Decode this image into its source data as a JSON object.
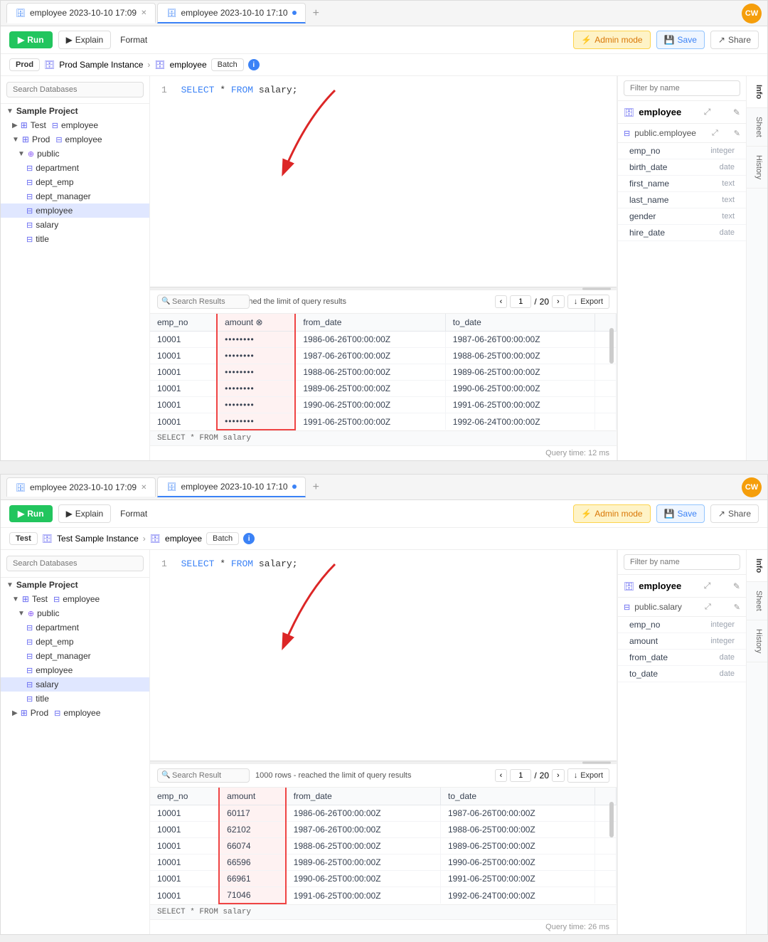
{
  "panel1": {
    "tabs": [
      {
        "id": "tab1",
        "label": "employee 2023-10-10 17:09",
        "active": true,
        "closable": true,
        "dot": false
      },
      {
        "id": "tab2",
        "label": "employee 2023-10-10 17:10",
        "active": false,
        "closable": false,
        "dot": true
      },
      {
        "id": "add",
        "label": "+",
        "active": false
      }
    ],
    "toolbar": {
      "run": "▶ Run",
      "explain": "▶ Explain",
      "format": "Format",
      "admin_mode": "⚡ Admin mode",
      "save": "💾 Save",
      "share": "↗ Share"
    },
    "context": {
      "env": "Prod",
      "instance": "Prod Sample Instance",
      "db": "employee",
      "batch": "Batch"
    },
    "sql": "SELECT * FROM salary;",
    "line_num": "1",
    "sidebar": {
      "search_placeholder": "Search Databases",
      "project_label": "Sample Project",
      "items": [
        {
          "type": "db",
          "label": "Test",
          "sub": "employee",
          "indent": 1
        },
        {
          "type": "db",
          "label": "Prod",
          "sub": "employee",
          "indent": 1
        },
        {
          "type": "schema",
          "label": "public",
          "indent": 2
        },
        {
          "type": "table",
          "label": "department",
          "indent": 3
        },
        {
          "type": "table",
          "label": "dept_emp",
          "indent": 3
        },
        {
          "type": "table",
          "label": "dept_manager",
          "indent": 3
        },
        {
          "type": "table",
          "label": "employee",
          "indent": 3,
          "selected": true
        },
        {
          "type": "table",
          "label": "salary",
          "indent": 3
        },
        {
          "type": "table",
          "label": "title",
          "indent": 3
        }
      ]
    },
    "results": {
      "search_placeholder": "Search Results",
      "info": "1000 rows - reached the limit of query results",
      "page": "1",
      "total_pages": "20",
      "export": "Export",
      "columns": [
        "emp_no",
        "amount",
        "from_date",
        "to_date"
      ],
      "rows": [
        [
          "10001",
          "••••••••",
          "1986-06-26T00:00:00Z",
          "1987-06-26T00:00:00Z"
        ],
        [
          "10001",
          "••••••••",
          "1987-06-26T00:00:00Z",
          "1988-06-25T00:00:00Z"
        ],
        [
          "10001",
          "••••••••",
          "1988-06-25T00:00:00Z",
          "1989-06-25T00:00:00Z"
        ],
        [
          "10001",
          "••••••••",
          "1989-06-25T00:00:00Z",
          "1990-06-25T00:00:00Z"
        ],
        [
          "10001",
          "••••••••",
          "1990-06-25T00:00:00Z",
          "1991-06-25T00:00:00Z"
        ],
        [
          "10001",
          "••••••••",
          "1991-06-25T00:00:00Z",
          "1992-06-24T00:00:00Z"
        ]
      ],
      "query_time": "Query time: 12 ms",
      "query_sql": "SELECT * FROM salary"
    },
    "right_panel": {
      "filter_placeholder": "Filter by name",
      "table_name": "employee",
      "schema_table": "public.employee",
      "fields": [
        {
          "name": "emp_no",
          "type": "integer"
        },
        {
          "name": "birth_date",
          "type": "date"
        },
        {
          "name": "first_name",
          "type": "text"
        },
        {
          "name": "last_name",
          "type": "text"
        },
        {
          "name": "gender",
          "type": "text"
        },
        {
          "name": "hire_date",
          "type": "date"
        }
      ],
      "tabs": [
        "Info",
        "Sheet",
        "History"
      ]
    },
    "avatar": "CW"
  },
  "panel2": {
    "tabs": [
      {
        "id": "tab1",
        "label": "employee 2023-10-10 17:09",
        "active": false,
        "closable": true,
        "dot": false
      },
      {
        "id": "tab2",
        "label": "employee 2023-10-10 17:10",
        "active": true,
        "closable": false,
        "dot": true
      },
      {
        "id": "add",
        "label": "+",
        "active": false
      }
    ],
    "toolbar": {
      "run": "▶ Run",
      "explain": "▶ Explain",
      "format": "Format",
      "admin_mode": "⚡ Admin mode",
      "save": "💾 Save",
      "share": "↗ Share"
    },
    "context": {
      "env": "Test",
      "instance": "Test Sample Instance",
      "db": "employee",
      "batch": "Batch"
    },
    "sql": "SELECT * FROM salary;",
    "line_num": "1",
    "sidebar": {
      "search_placeholder": "Search Databases",
      "project_label": "Sample Project",
      "items": [
        {
          "type": "db",
          "label": "Test",
          "sub": "employee",
          "indent": 1
        },
        {
          "type": "schema",
          "label": "public",
          "indent": 2
        },
        {
          "type": "table",
          "label": "department",
          "indent": 3
        },
        {
          "type": "table",
          "label": "dept_emp",
          "indent": 3
        },
        {
          "type": "table",
          "label": "dept_manager",
          "indent": 3
        },
        {
          "type": "table",
          "label": "employee",
          "indent": 3
        },
        {
          "type": "table",
          "label": "salary",
          "indent": 3,
          "selected": true
        },
        {
          "type": "table",
          "label": "title",
          "indent": 3
        },
        {
          "type": "db",
          "label": "Prod",
          "sub": "employee",
          "indent": 1
        }
      ]
    },
    "results": {
      "search_placeholder": "Search Result",
      "info": "1000 rows - reached the limit of query results",
      "page": "1",
      "total_pages": "20",
      "export": "Export",
      "columns": [
        "emp_no",
        "amount",
        "from_date",
        "to_date"
      ],
      "rows": [
        [
          "10001",
          "60117",
          "1986-06-26T00:00:00Z",
          "1987-06-26T00:00:00Z"
        ],
        [
          "10001",
          "62102",
          "1987-06-26T00:00:00Z",
          "1988-06-25T00:00:00Z"
        ],
        [
          "10001",
          "66074",
          "1988-06-25T00:00:00Z",
          "1989-06-25T00:00:00Z"
        ],
        [
          "10001",
          "66596",
          "1989-06-25T00:00:00Z",
          "1990-06-25T00:00:00Z"
        ],
        [
          "10001",
          "66961",
          "1990-06-25T00:00:00Z",
          "1991-06-25T00:00:00Z"
        ],
        [
          "10001",
          "71046",
          "1991-06-25T00:00:00Z",
          "1992-06-24T00:00:00Z"
        ]
      ],
      "query_time": "Query time: 26 ms",
      "query_sql": "SELECT * FROM salary"
    },
    "right_panel": {
      "filter_placeholder": "Filter by name",
      "table_name": "employee",
      "schema_table": "public.salary",
      "fields": [
        {
          "name": "emp_no",
          "type": "integer"
        },
        {
          "name": "amount",
          "type": "integer"
        },
        {
          "name": "from_date",
          "type": "date"
        },
        {
          "name": "to_date",
          "type": "date"
        }
      ],
      "tabs": [
        "Info",
        "Sheet",
        "History"
      ]
    },
    "avatar": "CW"
  }
}
